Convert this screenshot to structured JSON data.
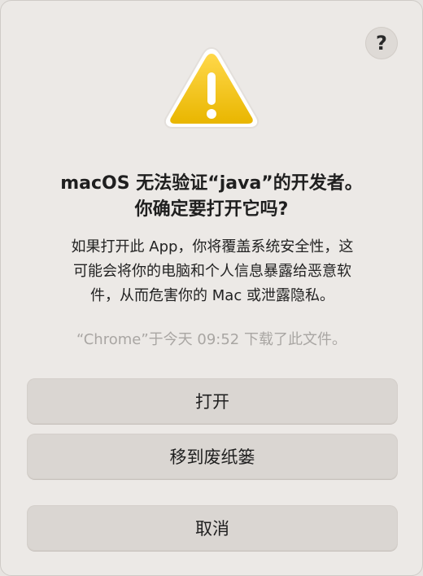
{
  "help": {
    "label": "?"
  },
  "title": {
    "line1": "macOS 无法验证“java”的开发者。",
    "line2": "你确定要打开它吗?"
  },
  "message": {
    "line1": "如果打开此 App，你将覆盖系统安全性，这",
    "line2": "可能会将你的电脑和个人信息暴露给恶意软",
    "line3": "件，从而危害你的 Mac 或泄露隐私。"
  },
  "source": "“Chrome”于今天 09:52 下载了此文件。",
  "buttons": {
    "open": "打开",
    "move_to_trash": "移到废纸篓",
    "cancel": "取消"
  },
  "colors": {
    "warning_yellow": "#f2c200",
    "dialog_bg": "#ece9e6",
    "button_bg": "#dad6d2"
  },
  "icons": {
    "warning": "warning-triangle-icon",
    "help": "question-mark-icon"
  }
}
